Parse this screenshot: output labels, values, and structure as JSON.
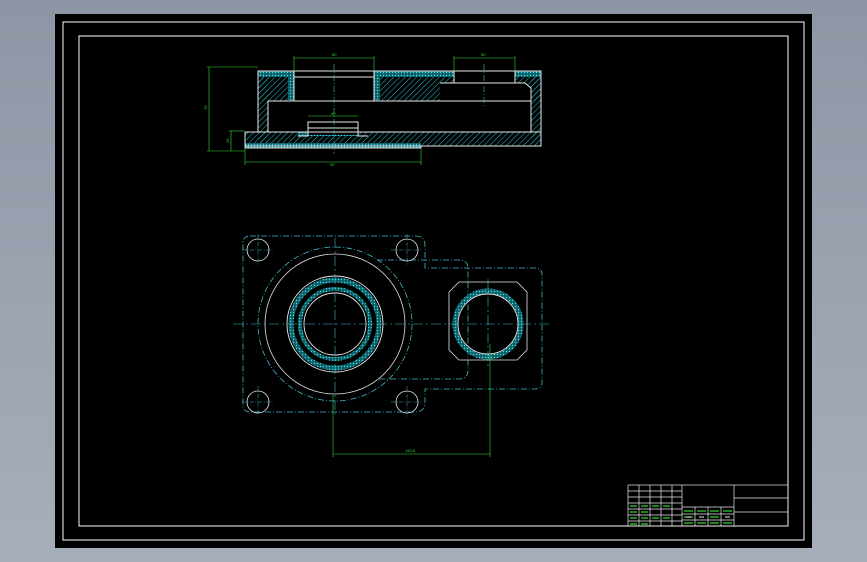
{
  "drawing": {
    "colors": {
      "background": "#000000",
      "frame": "#ffffff",
      "outline": "#e8e8e8",
      "centerline": "#3fb8c8",
      "hatch": "#20c0c8",
      "dimension": "#2fe02f"
    },
    "section_view": {
      "dims": {
        "top_bore_width": "60",
        "right_bore_width": "50",
        "overall_height": "70",
        "base_height": "15",
        "inner_bore_width": "40",
        "base_width": "90"
      }
    },
    "plan_view": {
      "dims": {
        "center_distance": "120.5"
      }
    },
    "title_block": {
      "cells": [
        "",
        "",
        "",
        ""
      ]
    }
  }
}
